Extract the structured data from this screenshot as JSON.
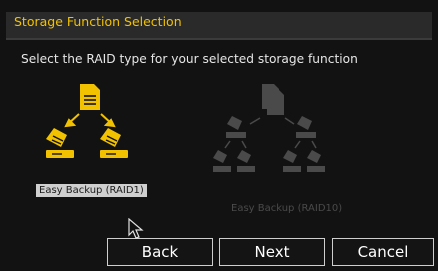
{
  "header": {
    "title": "Storage Function Selection"
  },
  "prompt": "Select the RAID type for your selected storage function",
  "options": [
    {
      "label": "Easy Backup (RAID1)",
      "selected": true,
      "icon": "raid1-icon"
    },
    {
      "label": "Easy Backup (RAID10)",
      "selected": false,
      "icon": "raid10-icon"
    }
  ],
  "buttons": {
    "back": "Back",
    "next": "Next",
    "cancel": "Cancel"
  },
  "colors": {
    "accent": "#f2c200",
    "disabled": "#4a4a4a",
    "background": "#121212"
  }
}
